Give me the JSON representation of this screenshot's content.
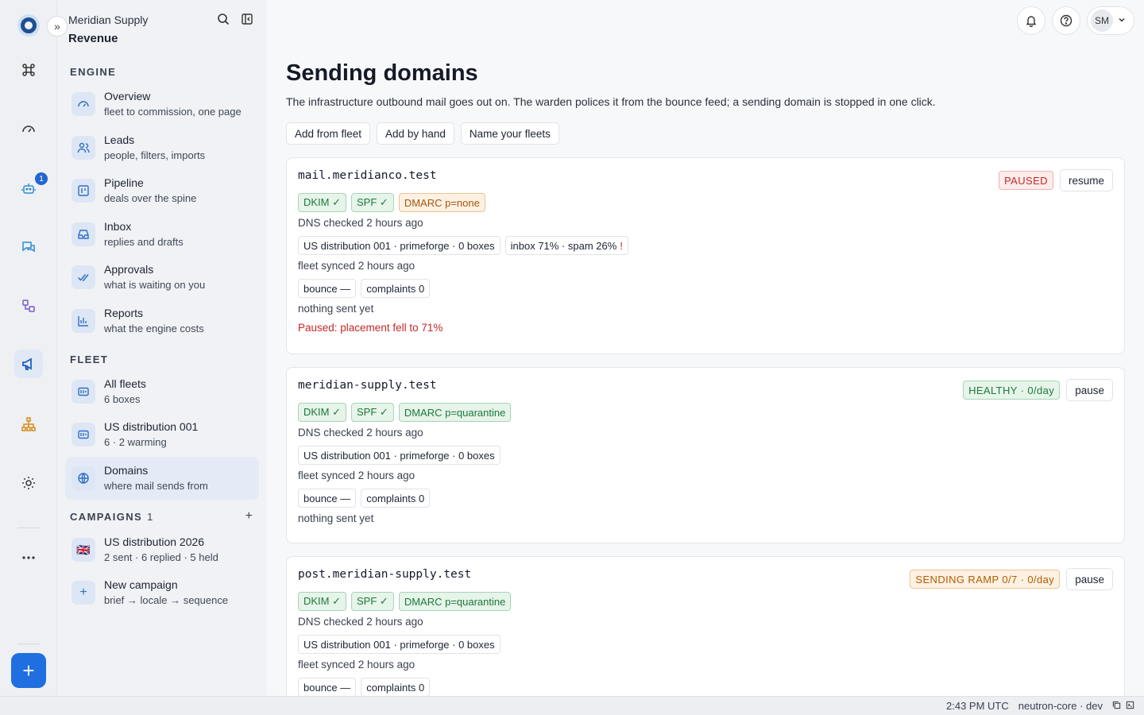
{
  "app": {
    "org_name": "Meridian Supply",
    "workspace": "Revenue"
  },
  "rail": {
    "badge_count": "1",
    "icons": [
      "logo-icon",
      "command-icon",
      "gauge-icon",
      "robot-icon",
      "chat-icon",
      "flow-icon",
      "megaphone-icon",
      "hierarchy-icon",
      "gear-icon",
      "more-icon"
    ]
  },
  "sidebar": {
    "engine_label": "ENGINE",
    "fleet_label": "FLEET",
    "campaigns_label": "CAMPAIGNS",
    "campaigns_count": "1",
    "engine_items": [
      {
        "title": "Overview",
        "sub": "fleet to commission, one page"
      },
      {
        "title": "Leads",
        "sub": "people, filters, imports"
      },
      {
        "title": "Pipeline",
        "sub": "deals over the spine"
      },
      {
        "title": "Inbox",
        "sub": "replies and drafts"
      },
      {
        "title": "Approvals",
        "sub": "what is waiting on you"
      },
      {
        "title": "Reports",
        "sub": "what the engine costs"
      }
    ],
    "fleet_items": [
      {
        "title": "All fleets",
        "sub": "6 boxes"
      },
      {
        "title": "US distribution 001",
        "sub": "6 · 2 warming"
      },
      {
        "title": "Domains",
        "sub": "where mail sends from"
      }
    ],
    "campaign_items": [
      {
        "title": "US distribution 2026",
        "sub": "2 sent · 6 replied · 5 held",
        "flag": "🇬🇧"
      },
      {
        "title": "New campaign",
        "sub": "brief → locale → sequence"
      }
    ]
  },
  "header": {
    "avatar_initials": "SM"
  },
  "page": {
    "title": "Sending domains",
    "description": "The infrastructure outbound mail goes out on. The warden polices it from the bounce feed; a sending domain is stopped in one click.",
    "actions": [
      "Add from fleet",
      "Add by hand",
      "Name your fleets"
    ]
  },
  "domains": [
    {
      "name": "mail.meridianco.test",
      "status": "PAUSED",
      "action": "resume",
      "dkim": "DKIM ✓",
      "spf": "SPF ✓",
      "dmarc": "DMARC p=none",
      "dns_checked": "DNS checked 2 hours ago",
      "fleet": "US distribution 001 · primeforge · 0 boxes",
      "placement": "inbox 71% · spam 26%",
      "placement_flag": "!",
      "fleet_synced": "fleet synced 2 hours ago",
      "bounce": "bounce —",
      "complaints": "complaints 0",
      "sent": "nothing sent yet",
      "error": "Paused: placement fell to 71%"
    },
    {
      "name": "meridian-supply.test",
      "status": "HEALTHY · 0/day",
      "action": "pause",
      "dkim": "DKIM ✓",
      "spf": "SPF ✓",
      "dmarc": "DMARC p=quarantine",
      "dns_checked": "DNS checked 2 hours ago",
      "fleet": "US distribution 001 · primeforge · 0 boxes",
      "fleet_synced": "fleet synced 2 hours ago",
      "bounce": "bounce —",
      "complaints": "complaints 0",
      "sent": "nothing sent yet"
    },
    {
      "name": "post.meridian-supply.test",
      "status": "SENDING RAMP 0/7 · 0/day",
      "action": "pause",
      "dkim": "DKIM ✓",
      "spf": "SPF ✓",
      "dmarc": "DMARC p=quarantine",
      "dns_checked": "DNS checked 2 hours ago",
      "fleet": "US distribution 001 · primeforge · 0 boxes",
      "fleet_synced": "fleet synced 2 hours ago",
      "bounce": "bounce —",
      "complaints": "complaints 0"
    }
  ],
  "footer": {
    "time": "2:43 PM UTC",
    "env": "neutron-core · dev"
  },
  "colors": {
    "accent": "#1f6fe0",
    "danger": "#c62828",
    "success": "#1d7a3a",
    "warning": "#b35c00"
  }
}
